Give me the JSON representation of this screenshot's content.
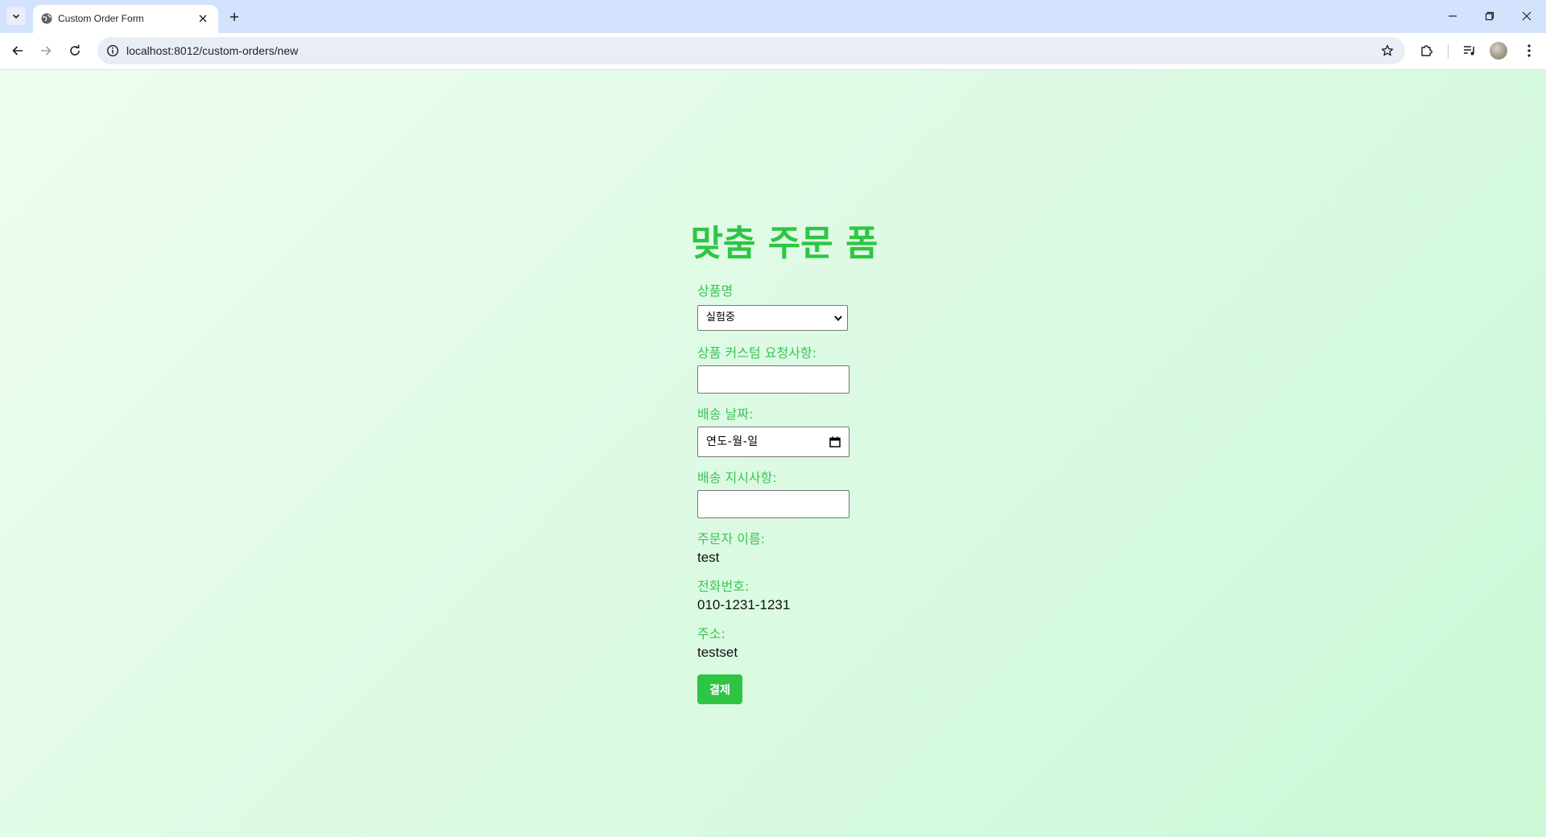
{
  "browser": {
    "tab_title": "Custom Order Form",
    "url": "localhost:8012/custom-orders/new"
  },
  "form": {
    "title": "맞춤 주문 폼",
    "product_label": "상품명",
    "product_selected": "실험중",
    "custom_request_label": "상품 커스텀 요청사항:",
    "custom_request_value": "",
    "delivery_date_label": "배송 날짜:",
    "delivery_date_placeholder": "연도-월-일",
    "delivery_instructions_label": "배송 지시사항:",
    "delivery_instructions_value": "",
    "orderer_name_label": "주문자 이름:",
    "orderer_name_value": "test",
    "phone_label": "전화번호:",
    "phone_value": "010-1231-1231",
    "address_label": "주소:",
    "address_value": "testset",
    "pay_button_label": "결제"
  },
  "theme": {
    "accent": "#2fc544",
    "label_color": "#3cc456",
    "background_start": "#eefdf0",
    "background_end": "#cbf8d6"
  }
}
